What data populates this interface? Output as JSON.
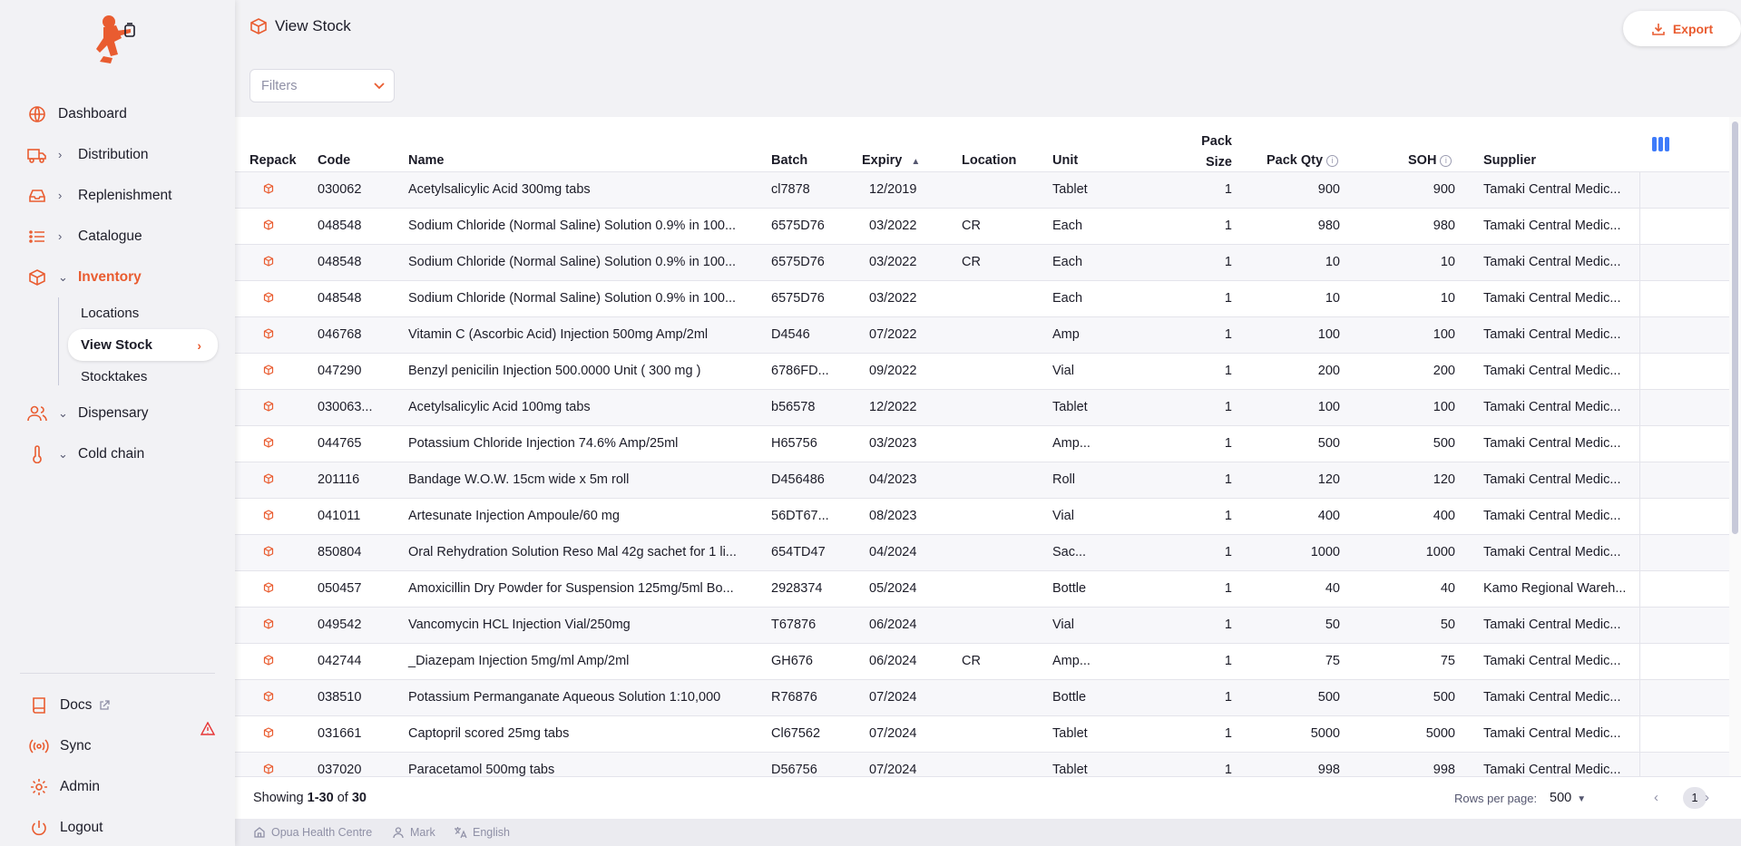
{
  "app": {
    "accent": "#e95c30"
  },
  "sidebar": {
    "items": [
      {
        "label": "Dashboard",
        "icon": "globe-icon",
        "chevron": false
      },
      {
        "label": "Distribution",
        "icon": "truck-icon",
        "chevron": "right"
      },
      {
        "label": "Replenishment",
        "icon": "inbox-icon",
        "chevron": "right"
      },
      {
        "label": "Catalogue",
        "icon": "list-icon",
        "chevron": "right"
      },
      {
        "label": "Inventory",
        "icon": "box-icon",
        "chevron": "down",
        "active": true
      }
    ],
    "inventory_sub": [
      {
        "label": "Locations"
      },
      {
        "label": "View Stock",
        "active": true
      },
      {
        "label": "Stocktakes"
      }
    ],
    "items_after": [
      {
        "label": "Dispensary",
        "icon": "people-icon",
        "chevron": "down"
      },
      {
        "label": "Cold chain",
        "icon": "thermometer-icon",
        "chevron": "down"
      }
    ],
    "bottom": [
      {
        "label": "Docs",
        "icon": "book-icon"
      },
      {
        "label": "Sync",
        "icon": "radio-icon"
      },
      {
        "label": "Admin",
        "icon": "gear-icon"
      },
      {
        "label": "Logout",
        "icon": "power-icon"
      }
    ]
  },
  "header": {
    "title": "View Stock",
    "export_label": "Export"
  },
  "filters": {
    "placeholder": "Filters"
  },
  "table": {
    "columns": {
      "repack": "Repack",
      "code": "Code",
      "name": "Name",
      "batch": "Batch",
      "expiry": "Expiry",
      "location": "Location",
      "unit": "Unit",
      "pack_size_1": "Pack",
      "pack_size_2": "Size",
      "pack_qty": "Pack Qty",
      "soh": "SOH",
      "supplier": "Supplier"
    },
    "rows": [
      {
        "code": "030062",
        "name": "Acetylsalicylic Acid 300mg tabs",
        "batch": "cl7878",
        "expiry": "12/2019",
        "location": "",
        "unit": "Tablet",
        "pack_size": "1",
        "pack_qty": "900",
        "soh": "900",
        "supplier": "Tamaki Central Medic..."
      },
      {
        "code": "048548",
        "name": "Sodium Chloride (Normal Saline) Solution 0.9% in 100...",
        "batch": "6575D76",
        "expiry": "03/2022",
        "location": "CR",
        "unit": "Each",
        "pack_size": "1",
        "pack_qty": "980",
        "soh": "980",
        "supplier": "Tamaki Central Medic..."
      },
      {
        "code": "048548",
        "name": "Sodium Chloride (Normal Saline) Solution 0.9% in 100...",
        "batch": "6575D76",
        "expiry": "03/2022",
        "location": "CR",
        "unit": "Each",
        "pack_size": "1",
        "pack_qty": "10",
        "soh": "10",
        "supplier": "Tamaki Central Medic..."
      },
      {
        "code": "048548",
        "name": "Sodium Chloride (Normal Saline) Solution 0.9% in 100...",
        "batch": "6575D76",
        "expiry": "03/2022",
        "location": "",
        "unit": "Each",
        "pack_size": "1",
        "pack_qty": "10",
        "soh": "10",
        "supplier": "Tamaki Central Medic..."
      },
      {
        "code": "046768",
        "name": "Vitamin C (Ascorbic Acid) Injection 500mg Amp/2ml",
        "batch": "D4546",
        "expiry": "07/2022",
        "location": "",
        "unit": "Amp",
        "pack_size": "1",
        "pack_qty": "100",
        "soh": "100",
        "supplier": "Tamaki Central Medic..."
      },
      {
        "code": "047290",
        "name": "Benzyl penicilin Injection 500.0000 Unit ( 300 mg )",
        "batch": "6786FD...",
        "expiry": "09/2022",
        "location": "",
        "unit": "Vial",
        "pack_size": "1",
        "pack_qty": "200",
        "soh": "200",
        "supplier": "Tamaki Central Medic..."
      },
      {
        "code": "030063...",
        "name": "Acetylsalicylic Acid 100mg tabs",
        "batch": "b56578",
        "expiry": "12/2022",
        "location": "",
        "unit": "Tablet",
        "pack_size": "1",
        "pack_qty": "100",
        "soh": "100",
        "supplier": "Tamaki Central Medic..."
      },
      {
        "code": "044765",
        "name": "Potassium Chloride Injection 74.6% Amp/25ml",
        "batch": "H65756",
        "expiry": "03/2023",
        "location": "",
        "unit": "Amp...",
        "pack_size": "1",
        "pack_qty": "500",
        "soh": "500",
        "supplier": "Tamaki Central Medic..."
      },
      {
        "code": "201116",
        "name": "Bandage W.O.W. 15cm wide x 5m roll",
        "batch": "D456486",
        "expiry": "04/2023",
        "location": "",
        "unit": "Roll",
        "pack_size": "1",
        "pack_qty": "120",
        "soh": "120",
        "supplier": "Tamaki Central Medic..."
      },
      {
        "code": "041011",
        "name": "Artesunate Injection Ampoule/60 mg",
        "batch": "56DT67...",
        "expiry": "08/2023",
        "location": "",
        "unit": "Vial",
        "pack_size": "1",
        "pack_qty": "400",
        "soh": "400",
        "supplier": "Tamaki Central Medic..."
      },
      {
        "code": "850804",
        "name": "Oral Rehydration Solution Reso Mal 42g sachet for 1 li...",
        "batch": "654TD47",
        "expiry": "04/2024",
        "location": "",
        "unit": "Sac...",
        "pack_size": "1",
        "pack_qty": "1000",
        "soh": "1000",
        "supplier": "Tamaki Central Medic..."
      },
      {
        "code": "050457",
        "name": "Amoxicillin Dry Powder for Suspension 125mg/5ml Bo...",
        "batch": "2928374",
        "expiry": "05/2024",
        "location": "",
        "unit": "Bottle",
        "pack_size": "1",
        "pack_qty": "40",
        "soh": "40",
        "supplier": "Kamo Regional Wareh..."
      },
      {
        "code": "049542",
        "name": "Vancomycin HCL Injection Vial/250mg",
        "batch": "T67876",
        "expiry": "06/2024",
        "location": "",
        "unit": "Vial",
        "pack_size": "1",
        "pack_qty": "50",
        "soh": "50",
        "supplier": "Tamaki Central Medic..."
      },
      {
        "code": "042744",
        "name": "_Diazepam Injection 5mg/ml Amp/2ml",
        "batch": "GH676",
        "expiry": "06/2024",
        "location": "CR",
        "unit": "Amp...",
        "pack_size": "1",
        "pack_qty": "75",
        "soh": "75",
        "supplier": "Tamaki Central Medic..."
      },
      {
        "code": "038510",
        "name": "Potassium Permanganate Aqueous Solution 1:10,000",
        "batch": "R76876",
        "expiry": "07/2024",
        "location": "",
        "unit": "Bottle",
        "pack_size": "1",
        "pack_qty": "500",
        "soh": "500",
        "supplier": "Tamaki Central Medic..."
      },
      {
        "code": "031661",
        "name": "Captopril scored 25mg tabs",
        "batch": "Cl67562",
        "expiry": "07/2024",
        "location": "",
        "unit": "Tablet",
        "pack_size": "1",
        "pack_qty": "5000",
        "soh": "5000",
        "supplier": "Tamaki Central Medic..."
      },
      {
        "code": "037020",
        "name": "Paracetamol 500mg tabs",
        "batch": "D56756",
        "expiry": "07/2024",
        "location": "",
        "unit": "Tablet",
        "pack_size": "1",
        "pack_qty": "998",
        "soh": "998",
        "supplier": "Tamaki Central Medic..."
      }
    ]
  },
  "pagination": {
    "showing_prefix": "Showing ",
    "range": "1-30",
    "of": " of ",
    "total": "30",
    "rows_per_page_label": "Rows per page:",
    "rows_per_page": "500",
    "current_page": "1"
  },
  "status": {
    "store": "Opua Health Centre",
    "user": "Mark",
    "language": "English"
  }
}
